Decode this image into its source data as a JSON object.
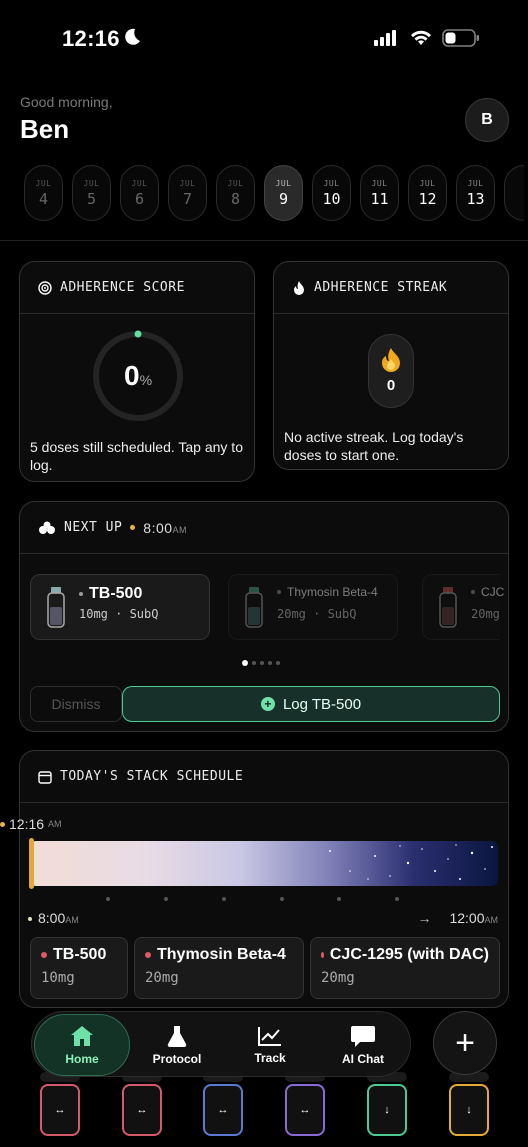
{
  "status": {
    "time": "12:16"
  },
  "greeting": {
    "line": "Good morning,",
    "name": "Ben",
    "avatar": "B"
  },
  "dates": [
    {
      "m": "JUL",
      "d": "4"
    },
    {
      "m": "JUL",
      "d": "5"
    },
    {
      "m": "JUL",
      "d": "6"
    },
    {
      "m": "JUL",
      "d": "7"
    },
    {
      "m": "JUL",
      "d": "8"
    },
    {
      "m": "JUL",
      "d": "9"
    },
    {
      "m": "JUL",
      "d": "10"
    },
    {
      "m": "JUL",
      "d": "11"
    },
    {
      "m": "JUL",
      "d": "12"
    },
    {
      "m": "JUL",
      "d": "13"
    }
  ],
  "adherence": {
    "title": "ADHERENCE SCORE",
    "value": "0",
    "unit": "%",
    "message": "5 doses still scheduled. Tap any to log."
  },
  "streak": {
    "title": "ADHERENCE STREAK",
    "value": "0",
    "message": "No active streak. Log today's doses to start one."
  },
  "next_up": {
    "title": "NEXT UP",
    "time": "8:00",
    "ampm": "AM",
    "doses": [
      {
        "name": "TB-500",
        "detail": "10mg · SubQ"
      },
      {
        "name": "Thymosin Beta-4",
        "detail": "20mg · SubQ"
      },
      {
        "name": "CJC",
        "detail": "20mg"
      }
    ],
    "dismiss": "Dismiss",
    "log": "Log TB-500"
  },
  "schedule": {
    "title": "TODAY'S STACK SCHEDULE",
    "now_time": "12:16",
    "now_ampm": "AM",
    "start": "8:00",
    "start_ampm": "AM",
    "end": "12:00",
    "end_ampm": "AM",
    "arrow": "→",
    "items": [
      {
        "name": "TB-500",
        "dose": "10mg"
      },
      {
        "name": "Thymosin Beta-4",
        "dose": "20mg"
      },
      {
        "name": "CJC-1295 (with DAC)",
        "dose": "20mg"
      }
    ]
  },
  "nav": {
    "items": [
      {
        "label": "Home",
        "icon": "home-icon"
      },
      {
        "label": "Protocol",
        "icon": "flask-icon"
      },
      {
        "label": "Track",
        "icon": "chart-icon"
      },
      {
        "label": "AI Chat",
        "icon": "chat-icon"
      }
    ],
    "fab": "+"
  },
  "colors": {
    "accent": "#4fc993",
    "streak": "#f0a81c",
    "dose_dot": "#e15a66",
    "now_marker": "#e5a93a"
  }
}
